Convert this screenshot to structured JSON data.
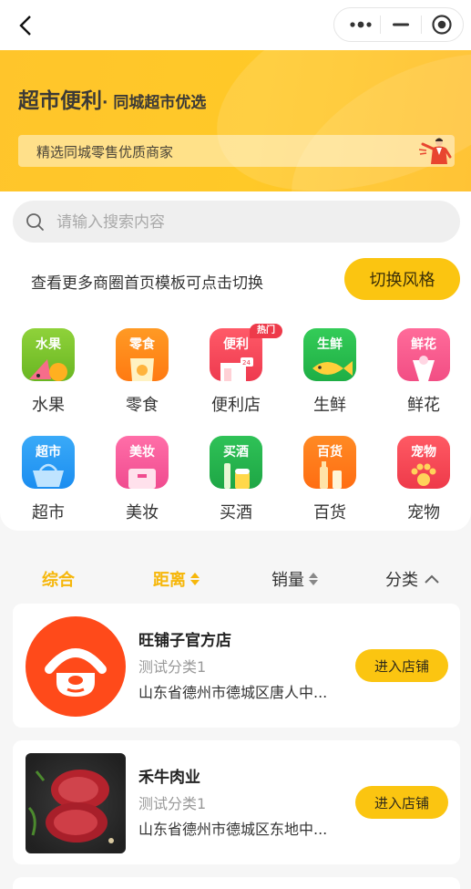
{
  "banner": {
    "title": "超市便利",
    "subtitle": "· 同城超市优选",
    "tagline": "精选同城零售优质商家"
  },
  "search": {
    "placeholder": "请输入搜索内容"
  },
  "template_tip": {
    "text": "查看更多商圈首页模板可点击切换",
    "button": "切换风格"
  },
  "categories": [
    {
      "icon_text": "水果",
      "label": "水果",
      "color": "#7cc62c"
    },
    {
      "icon_text": "零食",
      "label": "零食",
      "color": "#ff8c1a"
    },
    {
      "icon_text": "便利",
      "label": "便利店",
      "color": "#f4485b"
    },
    {
      "icon_text": "生鲜",
      "label": "生鲜",
      "color": "#2ec24f"
    },
    {
      "icon_text": "鲜花",
      "label": "鲜花",
      "color": "#f9588b"
    },
    {
      "icon_text": "超市",
      "label": "超市",
      "color": "#2a9cf5"
    },
    {
      "icon_text": "美妆",
      "label": "美妆",
      "color": "#f35a9a"
    },
    {
      "icon_text": "买酒",
      "label": "买酒",
      "color": "#23b54a"
    },
    {
      "icon_text": "百货",
      "label": "百货",
      "color": "#ff7f1a"
    },
    {
      "icon_text": "宠物",
      "label": "宠物",
      "color": "#f24954"
    }
  ],
  "hot_badge": "热门",
  "sort": {
    "overall": "综合",
    "distance": "距离",
    "sales": "销量",
    "category": "分类"
  },
  "stores": [
    {
      "name": "旺铺子官方店",
      "category": "测试分类1",
      "address": "山东省德州市德城区唐人中...",
      "button": "进入店铺"
    },
    {
      "name": "禾牛肉业",
      "category": "测试分类1",
      "address": "山东省德州市德城区东地中...",
      "button": "进入店铺"
    }
  ],
  "colors": {
    "accent": "#fbc511",
    "active_sort": "#f6b70b",
    "logo_red": "#ff4a1a"
  }
}
